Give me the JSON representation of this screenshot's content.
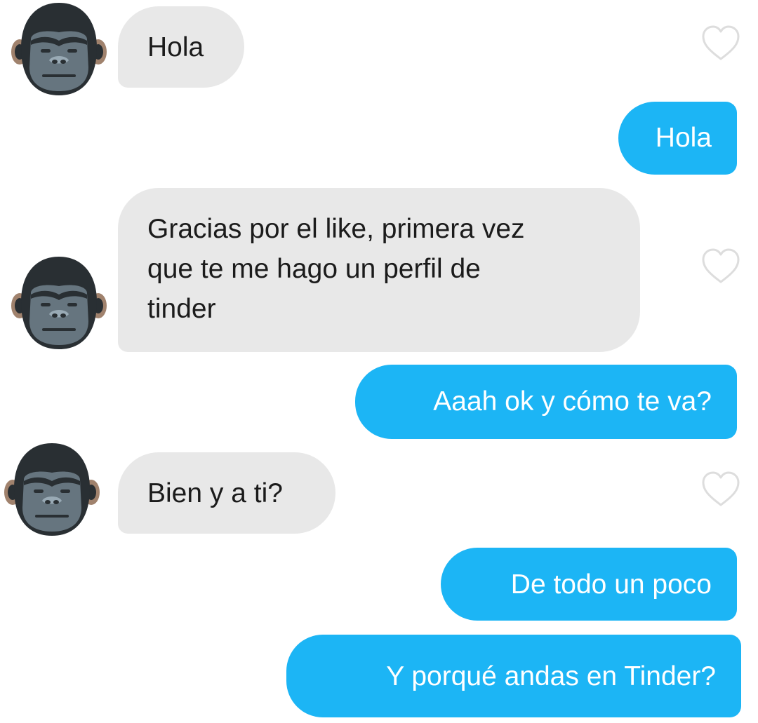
{
  "colors": {
    "incoming_bubble": "#e8e8e8",
    "outgoing_bubble": "#1cb5f5",
    "incoming_text": "#1b1b1b",
    "outgoing_text": "#ffffff",
    "heart_outline": "#dddddd"
  },
  "icons": {
    "avatar": "gorilla-emoji-icon",
    "like": "heart-outline-icon"
  },
  "messages": [
    {
      "sender": "match",
      "lines": [
        "Hola"
      ]
    },
    {
      "sender": "me",
      "lines": [
        "Hola"
      ]
    },
    {
      "sender": "match",
      "lines": [
        "Gracias por el like, primera vez",
        "que te me hago un perfil de",
        "tinder"
      ]
    },
    {
      "sender": "me",
      "lines": [
        "Aaah ok y cómo te va?"
      ]
    },
    {
      "sender": "match",
      "lines": [
        "Bien y a ti?"
      ]
    },
    {
      "sender": "me",
      "lines": [
        "De todo un poco"
      ]
    },
    {
      "sender": "me",
      "lines": [
        "Y porqué andas en Tinder?"
      ]
    }
  ]
}
